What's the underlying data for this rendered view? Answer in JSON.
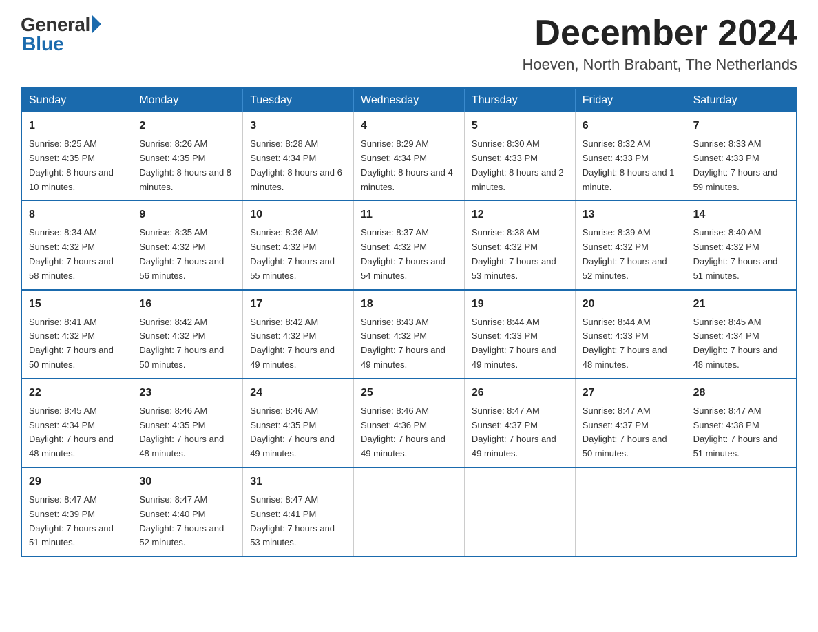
{
  "logo": {
    "general": "General",
    "blue": "Blue"
  },
  "title": {
    "month_year": "December 2024",
    "location": "Hoeven, North Brabant, The Netherlands"
  },
  "days_of_week": [
    "Sunday",
    "Monday",
    "Tuesday",
    "Wednesday",
    "Thursday",
    "Friday",
    "Saturday"
  ],
  "weeks": [
    [
      {
        "day": "1",
        "sunrise": "8:25 AM",
        "sunset": "4:35 PM",
        "daylight": "8 hours and 10 minutes."
      },
      {
        "day": "2",
        "sunrise": "8:26 AM",
        "sunset": "4:35 PM",
        "daylight": "8 hours and 8 minutes."
      },
      {
        "day": "3",
        "sunrise": "8:28 AM",
        "sunset": "4:34 PM",
        "daylight": "8 hours and 6 minutes."
      },
      {
        "day": "4",
        "sunrise": "8:29 AM",
        "sunset": "4:34 PM",
        "daylight": "8 hours and 4 minutes."
      },
      {
        "day": "5",
        "sunrise": "8:30 AM",
        "sunset": "4:33 PM",
        "daylight": "8 hours and 2 minutes."
      },
      {
        "day": "6",
        "sunrise": "8:32 AM",
        "sunset": "4:33 PM",
        "daylight": "8 hours and 1 minute."
      },
      {
        "day": "7",
        "sunrise": "8:33 AM",
        "sunset": "4:33 PM",
        "daylight": "7 hours and 59 minutes."
      }
    ],
    [
      {
        "day": "8",
        "sunrise": "8:34 AM",
        "sunset": "4:32 PM",
        "daylight": "7 hours and 58 minutes."
      },
      {
        "day": "9",
        "sunrise": "8:35 AM",
        "sunset": "4:32 PM",
        "daylight": "7 hours and 56 minutes."
      },
      {
        "day": "10",
        "sunrise": "8:36 AM",
        "sunset": "4:32 PM",
        "daylight": "7 hours and 55 minutes."
      },
      {
        "day": "11",
        "sunrise": "8:37 AM",
        "sunset": "4:32 PM",
        "daylight": "7 hours and 54 minutes."
      },
      {
        "day": "12",
        "sunrise": "8:38 AM",
        "sunset": "4:32 PM",
        "daylight": "7 hours and 53 minutes."
      },
      {
        "day": "13",
        "sunrise": "8:39 AM",
        "sunset": "4:32 PM",
        "daylight": "7 hours and 52 minutes."
      },
      {
        "day": "14",
        "sunrise": "8:40 AM",
        "sunset": "4:32 PM",
        "daylight": "7 hours and 51 minutes."
      }
    ],
    [
      {
        "day": "15",
        "sunrise": "8:41 AM",
        "sunset": "4:32 PM",
        "daylight": "7 hours and 50 minutes."
      },
      {
        "day": "16",
        "sunrise": "8:42 AM",
        "sunset": "4:32 PM",
        "daylight": "7 hours and 50 minutes."
      },
      {
        "day": "17",
        "sunrise": "8:42 AM",
        "sunset": "4:32 PM",
        "daylight": "7 hours and 49 minutes."
      },
      {
        "day": "18",
        "sunrise": "8:43 AM",
        "sunset": "4:32 PM",
        "daylight": "7 hours and 49 minutes."
      },
      {
        "day": "19",
        "sunrise": "8:44 AM",
        "sunset": "4:33 PM",
        "daylight": "7 hours and 49 minutes."
      },
      {
        "day": "20",
        "sunrise": "8:44 AM",
        "sunset": "4:33 PM",
        "daylight": "7 hours and 48 minutes."
      },
      {
        "day": "21",
        "sunrise": "8:45 AM",
        "sunset": "4:34 PM",
        "daylight": "7 hours and 48 minutes."
      }
    ],
    [
      {
        "day": "22",
        "sunrise": "8:45 AM",
        "sunset": "4:34 PM",
        "daylight": "7 hours and 48 minutes."
      },
      {
        "day": "23",
        "sunrise": "8:46 AM",
        "sunset": "4:35 PM",
        "daylight": "7 hours and 48 minutes."
      },
      {
        "day": "24",
        "sunrise": "8:46 AM",
        "sunset": "4:35 PM",
        "daylight": "7 hours and 49 minutes."
      },
      {
        "day": "25",
        "sunrise": "8:46 AM",
        "sunset": "4:36 PM",
        "daylight": "7 hours and 49 minutes."
      },
      {
        "day": "26",
        "sunrise": "8:47 AM",
        "sunset": "4:37 PM",
        "daylight": "7 hours and 49 minutes."
      },
      {
        "day": "27",
        "sunrise": "8:47 AM",
        "sunset": "4:37 PM",
        "daylight": "7 hours and 50 minutes."
      },
      {
        "day": "28",
        "sunrise": "8:47 AM",
        "sunset": "4:38 PM",
        "daylight": "7 hours and 51 minutes."
      }
    ],
    [
      {
        "day": "29",
        "sunrise": "8:47 AM",
        "sunset": "4:39 PM",
        "daylight": "7 hours and 51 minutes."
      },
      {
        "day": "30",
        "sunrise": "8:47 AM",
        "sunset": "4:40 PM",
        "daylight": "7 hours and 52 minutes."
      },
      {
        "day": "31",
        "sunrise": "8:47 AM",
        "sunset": "4:41 PM",
        "daylight": "7 hours and 53 minutes."
      },
      null,
      null,
      null,
      null
    ]
  ]
}
